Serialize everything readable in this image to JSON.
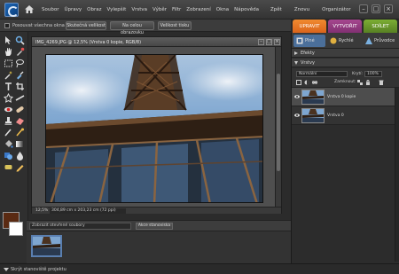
{
  "menu": {
    "items": [
      "Soubor",
      "Úpravy",
      "Obraz",
      "Vylepšit",
      "Vrstva",
      "Výběr",
      "Filtr",
      "Zobrazení",
      "Okna",
      "Nápověda"
    ],
    "right": [
      "Zpět",
      "Znovu",
      "Organizátor"
    ]
  },
  "mode_tabs": {
    "edit": "UPRAVIT",
    "create": "VYTVOŘIT",
    "share": "SDÍLET"
  },
  "options": {
    "check_label": "Posouvat všechna okna",
    "buttons": [
      "Skutečná velikost",
      "Na celou obrazovku",
      "Velikost tisku"
    ]
  },
  "document": {
    "title": "IMG_4269.JPG @ 12,5% (Vrstva 0 kopie, RGB/8)",
    "zoom": "12,5%",
    "size": "304,89 cm x 203,23 cm (72 ppi)"
  },
  "bin": {
    "select": "Zobrazit otevřené soubory",
    "button": "Akce stanoviska"
  },
  "status": {
    "text": "Skrýt stanoviště projektu"
  },
  "panel": {
    "tabs": [
      "Plné",
      "Rychlé",
      "Průvodce"
    ],
    "effects": "Efekty",
    "layers": "Vrstvy",
    "blend_mode": "Normální",
    "opacity_label": "Krytí:",
    "opacity_value": "100%",
    "lock_label": "Zamknout:",
    "layer_items": [
      "Vrstva 0 kopie",
      "Vrstva 0"
    ]
  },
  "colors": {
    "accent_edit": "#e8711c",
    "accent_create": "#9b3a8c",
    "accent_share": "#6a9a2a",
    "foreground_swatch": "#5a2a12"
  }
}
